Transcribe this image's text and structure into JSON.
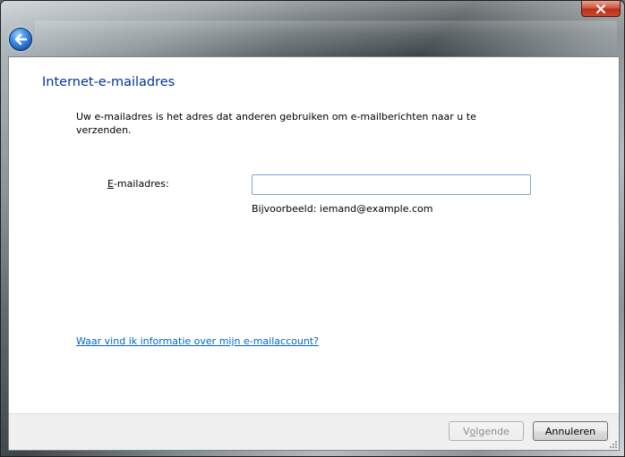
{
  "window": {
    "close_icon": "close-icon",
    "back_icon": "back-arrow-icon"
  },
  "page": {
    "heading": "Internet-e-mailadres",
    "description": "Uw e-mailadres is het adres dat anderen gebruiken om e-mailberichten naar u te verzenden."
  },
  "email": {
    "label_accel": "E",
    "label_rest": "-mailadres:",
    "value": "",
    "placeholder": "",
    "example": "Bijvoorbeeld: iemand@example.com"
  },
  "help_link": "Waar vind ik informatie over mijn e-mailaccount?",
  "buttons": {
    "next_before": "V",
    "next_accel": "o",
    "next_after": "lgende",
    "cancel": "Annuleren"
  },
  "colors": {
    "heading": "#003399",
    "link": "#0066cc",
    "close_button": "#c9492f",
    "back_button": "#3d8ee8"
  }
}
